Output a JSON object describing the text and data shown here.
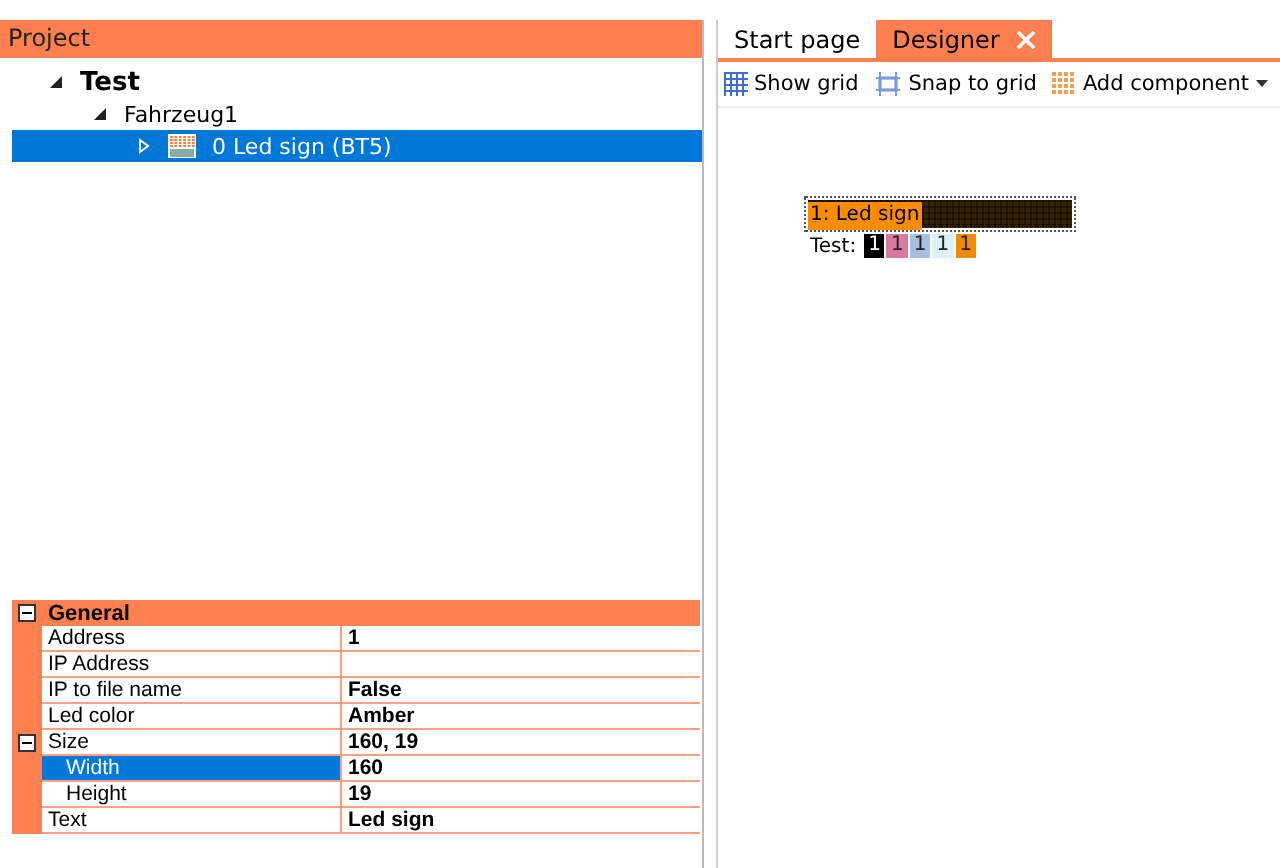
{
  "project_panel": {
    "title": "Project",
    "tree": [
      {
        "label": "Test",
        "expanded": true,
        "selected": false,
        "kind": "project",
        "children": [
          {
            "label": "Fahrzeug1",
            "expanded": true,
            "selected": false,
            "kind": "vehicle",
            "children": [
              {
                "label": "0 Led sign (BT5)",
                "expanded": false,
                "selected": true,
                "kind": "device"
              }
            ]
          }
        ]
      }
    ]
  },
  "property_grid": {
    "categories": [
      {
        "name": "General",
        "expanded": true,
        "properties": [
          {
            "name": "Address",
            "value": "1",
            "selected": false
          },
          {
            "name": "IP Address",
            "selected": false
          },
          {
            "name": "IP to file name",
            "value": "False",
            "selected": false
          },
          {
            "name": "Led color",
            "value": "Amber",
            "selected": false
          },
          {
            "name": "Size",
            "value": "160, 19",
            "selected": false,
            "expanded": true,
            "children": [
              {
                "name": "Width",
                "value": "160",
                "selected": true
              },
              {
                "name": "Height",
                "value": "19",
                "selected": false
              }
            ]
          },
          {
            "name": "Text",
            "value": "Led sign",
            "selected": false
          }
        ]
      }
    ]
  },
  "tabs": [
    {
      "label": "Start page",
      "selected": false,
      "closable": false
    },
    {
      "label": "Designer",
      "selected": true,
      "closable": true
    }
  ],
  "toolbar": [
    {
      "label": "Show grid",
      "kind": "grid"
    },
    {
      "label": "Snap to grid",
      "kind": "snap"
    },
    {
      "label": "Add component",
      "kind": "add",
      "dropdown": true
    }
  ],
  "designer": {
    "led_sign": {
      "label": "1: Led sign"
    },
    "test_label": "Test:",
    "test_chips": [
      {
        "text": "1",
        "color": "#000000"
      },
      {
        "text": "1",
        "color": "#d87aa0"
      },
      {
        "text": "1",
        "color": "#a8bfe0"
      },
      {
        "text": "1",
        "color": "#dcf0f8"
      },
      {
        "text": "1",
        "color": "#f08a00"
      }
    ]
  }
}
